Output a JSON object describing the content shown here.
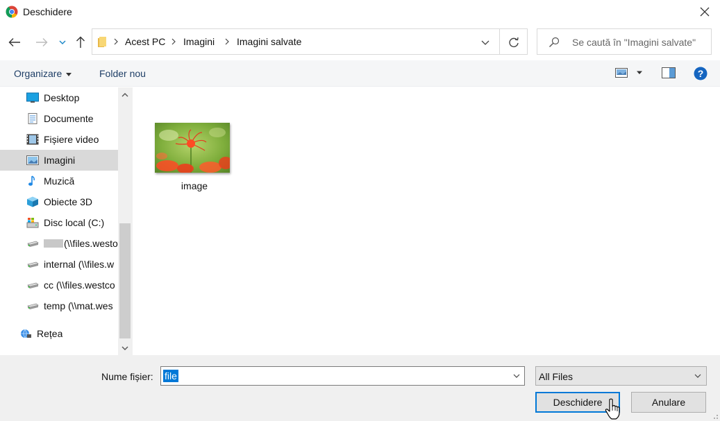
{
  "window": {
    "title": "Deschidere",
    "app_icon": "chrome-icon",
    "close_icon": "close-icon"
  },
  "nav": {
    "back_icon": "arrow-left-icon",
    "forward_icon": "arrow-right-icon",
    "recent_icon": "chevron-down-icon",
    "up_icon": "arrow-up-icon",
    "breadcrumb": [
      "Acest PC",
      "Imagini",
      "Imagini salvate"
    ],
    "refresh_icon": "refresh-icon",
    "search_placeholder": "Se caută în \"Imagini salvate\""
  },
  "toolbar": {
    "organize_label": "Organizare",
    "new_folder_label": "Folder nou",
    "view_icon": "view-mode-icon",
    "preview_icon": "preview-pane-icon",
    "help_icon": "help-icon"
  },
  "sidebar": {
    "items": [
      {
        "label": "Desktop",
        "icon": "desktop-icon",
        "selected": false
      },
      {
        "label": "Documente",
        "icon": "documents-icon",
        "selected": false
      },
      {
        "label": "Fișiere video",
        "icon": "video-icon",
        "selected": false
      },
      {
        "label": "Imagini",
        "icon": "pictures-icon",
        "selected": true
      },
      {
        "label": "Muzică",
        "icon": "music-icon",
        "selected": false
      },
      {
        "label": "Obiecte 3D",
        "icon": "3d-objects-icon",
        "selected": false
      },
      {
        "label": "Disc local (C:)",
        "icon": "local-disk-icon",
        "selected": false
      },
      {
        "label": "(\\\\files.westo",
        "icon": "network-drive-icon",
        "selected": false
      },
      {
        "label": "internal (\\\\files.w",
        "icon": "network-drive-icon",
        "selected": false
      },
      {
        "label": "cc (\\\\files.westco",
        "icon": "network-drive-icon",
        "selected": false
      },
      {
        "label": "temp (\\\\mat.wes",
        "icon": "network-drive-icon",
        "selected": false
      },
      {
        "label": "Rețea",
        "icon": "network-icon",
        "selected": false
      }
    ]
  },
  "content": {
    "files": [
      {
        "name": "image",
        "icon": "image-thumbnail"
      }
    ]
  },
  "footer": {
    "filename_label": "Nume fișier:",
    "filename_value": "file",
    "filetype_value": "All Files",
    "open_label": "Deschidere",
    "cancel_label": "Anulare"
  },
  "colors": {
    "accent": "#0078d7",
    "toolbar_text": "#1e3e66",
    "selected_bg": "#d9d9d9"
  }
}
